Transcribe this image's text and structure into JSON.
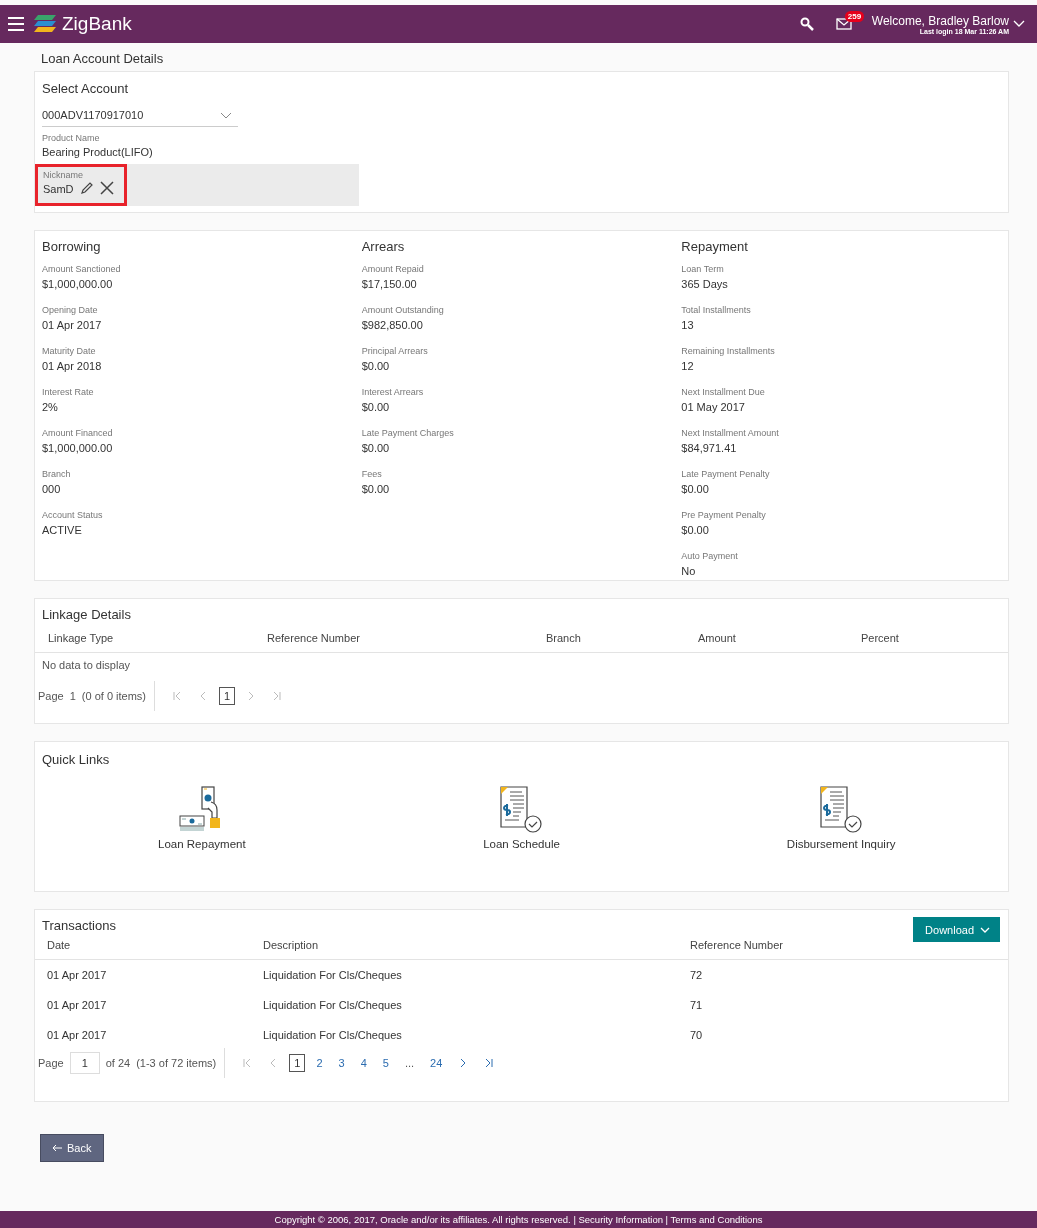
{
  "header": {
    "brand": "ZigBank",
    "mail_count": "259",
    "welcome": "Welcome, Bradley Barlow",
    "last_login": "Last login 18 Mar 11:26 AM"
  },
  "page_title": "Loan Account Details",
  "account": {
    "label": "Select Account",
    "value": "000ADV1170917010",
    "product_label": "Product Name",
    "product_value": "Bearing Product(LIFO)",
    "nickname_label": "Nickname",
    "nickname_value": "SamD",
    "highlighted": true
  },
  "summary": [
    {
      "title": "Borrowing",
      "fields": [
        {
          "label": "Amount Sanctioned",
          "value": "$1,000,000.00"
        },
        {
          "label": "Opening Date",
          "value": "01 Apr 2017"
        },
        {
          "label": "Maturity Date",
          "value": "01 Apr 2018"
        },
        {
          "label": "Interest Rate",
          "value": "2%"
        },
        {
          "label": "Amount Financed",
          "value": "$1,000,000.00"
        },
        {
          "label": "Branch",
          "value": "000"
        },
        {
          "label": "Account Status",
          "value": "ACTIVE"
        }
      ]
    },
    {
      "title": "Arrears",
      "fields": [
        {
          "label": "Amount Repaid",
          "value": "$17,150.00"
        },
        {
          "label": "Amount Outstanding",
          "value": "$982,850.00"
        },
        {
          "label": "Principal Arrears",
          "value": "$0.00"
        },
        {
          "label": "Interest Arrears",
          "value": "$0.00"
        },
        {
          "label": "Late Payment Charges",
          "value": "$0.00"
        },
        {
          "label": "Fees",
          "value": "$0.00"
        }
      ]
    },
    {
      "title": "Repayment",
      "fields": [
        {
          "label": "Loan Term",
          "value": "365 Days"
        },
        {
          "label": "Total Installments",
          "value": "13"
        },
        {
          "label": "Remaining Installments",
          "value": "12"
        },
        {
          "label": "Next Installment Due",
          "value": "01 May 2017"
        },
        {
          "label": "Next Installment Amount",
          "value": "$84,971.41"
        },
        {
          "label": "Late Payment Penalty",
          "value": "$0.00"
        },
        {
          "label": "Pre Payment Penalty",
          "value": "$0.00"
        },
        {
          "label": "Auto Payment",
          "value": "No"
        }
      ]
    }
  ],
  "linkage": {
    "title": "Linkage Details",
    "columns": [
      "Linkage Type",
      "Reference Number",
      "Branch",
      "Amount",
      "Percent"
    ],
    "empty": "No data to display",
    "pager": {
      "label": "Page",
      "kind": "text",
      "page": "1",
      "summary": "(0 of 0 items)",
      "back_enabled": false,
      "forward_enabled": false,
      "pages": [
        {
          "label": "1",
          "kind": "page",
          "selected": true
        }
      ]
    }
  },
  "quick_links": {
    "title": "Quick Links",
    "items": [
      {
        "label": "Loan Repayment",
        "kind": "repayment"
      },
      {
        "label": "Loan Schedule",
        "kind": "document"
      },
      {
        "label": "Disbursement Inquiry",
        "kind": "document"
      }
    ]
  },
  "transactions": {
    "title": "Transactions",
    "download": "Download",
    "columns": [
      "Date",
      "Description",
      "Reference Number"
    ],
    "rows": [
      [
        "01 Apr 2017",
        "Liquidation For Cls/Cheques",
        "72"
      ],
      [
        "01 Apr 2017",
        "Liquidation For Cls/Cheques",
        "71"
      ],
      [
        "01 Apr 2017",
        "Liquidation For Cls/Cheques",
        "70"
      ]
    ],
    "pager": {
      "label": "Page",
      "kind": "field",
      "page": "1",
      "of": "of 24",
      "summary": "(1-3 of 72 items)",
      "back_enabled": false,
      "forward_enabled": true,
      "pages": [
        {
          "label": "1",
          "kind": "page",
          "selected": true
        },
        {
          "label": "2",
          "kind": "page",
          "selected": false
        },
        {
          "label": "3",
          "kind": "page",
          "selected": false
        },
        {
          "label": "4",
          "kind": "page",
          "selected": false
        },
        {
          "label": "5",
          "kind": "page",
          "selected": false
        },
        {
          "label": "...",
          "kind": "gap"
        },
        {
          "label": "24",
          "kind": "page",
          "selected": false
        }
      ]
    }
  },
  "back": "Back",
  "footer": "Copyright © 2006, 2017, Oracle and/or its affiliates. All rights reserved. | Security Information | Terms and Conditions"
}
